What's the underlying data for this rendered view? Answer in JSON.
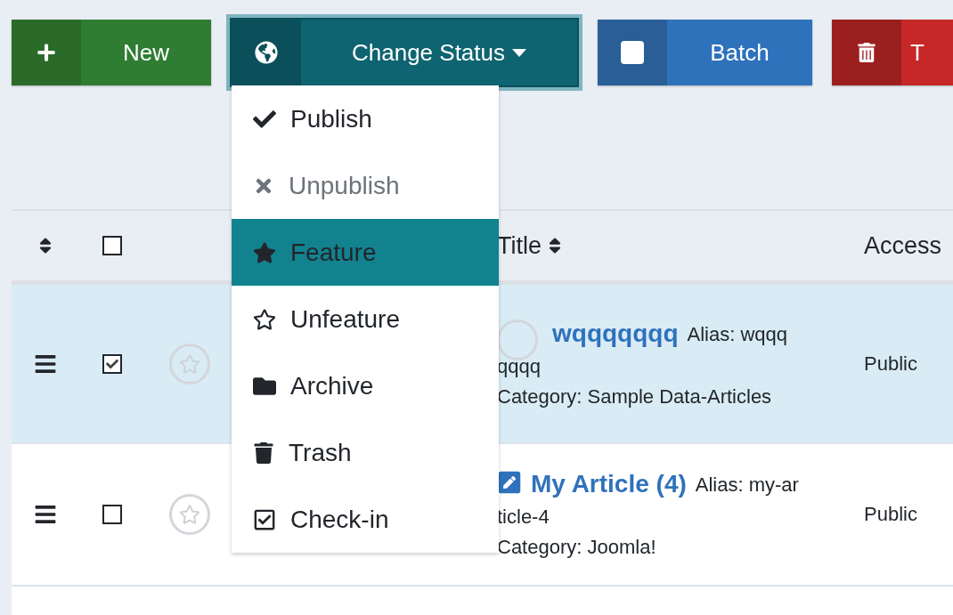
{
  "toolbar": {
    "buttons": [
      {
        "label": "New",
        "kind": "new",
        "expanded": false
      },
      {
        "label": "Change Status",
        "kind": "status",
        "expanded": true
      },
      {
        "label": "Batch",
        "kind": "batch",
        "expanded": false
      },
      {
        "label": "T",
        "kind": "trash",
        "expanded": false
      }
    ]
  },
  "status_menu": {
    "items": [
      {
        "label": "Publish",
        "disabled": false,
        "selected": false
      },
      {
        "label": "Unpublish",
        "disabled": true,
        "selected": false
      },
      {
        "label": "Feature",
        "disabled": false,
        "selected": true
      },
      {
        "label": "Unfeature",
        "disabled": false,
        "selected": false
      },
      {
        "label": "Archive",
        "disabled": false,
        "selected": false
      },
      {
        "label": "Trash",
        "disabled": false,
        "selected": false
      },
      {
        "label": "Check-in",
        "disabled": false,
        "selected": false
      }
    ]
  },
  "table": {
    "header": {
      "select_all_checked": false,
      "title": "Title",
      "access": "Access"
    },
    "rows": [
      {
        "checked": true,
        "featured": false,
        "kind": "circle",
        "title": "wqqqqqqq",
        "alias": "Alias: wqqq",
        "alias_cont": "qqqq",
        "category": "Category: Sample Data-Articles",
        "access": "Public"
      },
      {
        "checked": false,
        "featured": false,
        "kind": "edit",
        "title": "My Article (4)",
        "alias": "Alias: my-ar",
        "alias_cont": "ticle-4",
        "category": "Category: Joomla!",
        "access": "Public"
      }
    ]
  }
}
